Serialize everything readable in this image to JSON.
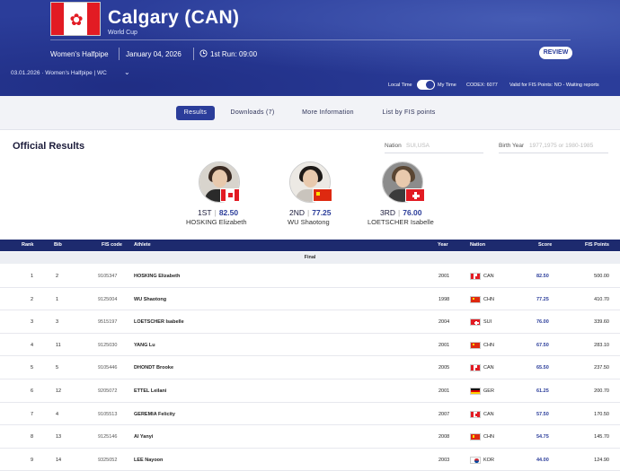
{
  "header": {
    "title": "Calgary (CAN)",
    "subtitle": "World Cup",
    "discipline": "Women's Halfpipe",
    "date": "January 04, 2026",
    "first_run": "1st Run: 09:00",
    "review_label": "REVIEW",
    "breadcrumb": "03.01.2026 · Women's Halfpipe | WC",
    "local_time": "Local Time",
    "my_time": "My Time",
    "codex": "CODEX: 6077",
    "fis_points": "Valid for FIS Points: NO - Waiting reports",
    "colors": {
      "primary": "#2b3d9a",
      "dark": "#1d2a6e"
    }
  },
  "tabs": [
    {
      "label": "Results",
      "active": true
    },
    {
      "label": "Downloads (7)",
      "active": false
    },
    {
      "label": "More Information",
      "active": false
    },
    {
      "label": "List by FIS points",
      "active": false
    }
  ],
  "filters": {
    "title": "Official Results",
    "nation_label": "Nation",
    "nation_placeholder": "SUI,USA",
    "birth_label": "Birth Year",
    "birth_placeholder": "1977,1975 or 1980-1985"
  },
  "podium": [
    {
      "place": "1ST",
      "score": "82.50",
      "name": "HOSKING Elizabeth",
      "nation": "CAN"
    },
    {
      "place": "2ND",
      "score": "77.25",
      "name": "WU Shaotong",
      "nation": "CHN"
    },
    {
      "place": "3RD",
      "score": "76.00",
      "name": "LOETSCHER Isabelle",
      "nation": "SUI"
    }
  ],
  "table": {
    "columns": {
      "rank": "Rank",
      "bib": "Bib",
      "fis_code": "FIS code",
      "athlete": "Athlete",
      "year": "Year",
      "nation": "Nation",
      "score": "Score",
      "fis_points": "FIS Points"
    },
    "section": "Final",
    "rows": [
      {
        "rank": "1",
        "bib": "2",
        "code": "9105347",
        "athlete": "HOSKING Elizabeth",
        "year": "2001",
        "nation": "CAN",
        "score": "82.50",
        "points": "500.00"
      },
      {
        "rank": "2",
        "bib": "1",
        "code": "9125004",
        "athlete": "WU Shaotong",
        "year": "1998",
        "nation": "CHN",
        "score": "77.25",
        "points": "410.70"
      },
      {
        "rank": "3",
        "bib": "3",
        "code": "9515197",
        "athlete": "LOETSCHER Isabelle",
        "year": "2004",
        "nation": "SUI",
        "score": "76.00",
        "points": "339.60"
      },
      {
        "rank": "4",
        "bib": "11",
        "code": "9125030",
        "athlete": "YANG Lu",
        "year": "2001",
        "nation": "CHN",
        "score": "67.50",
        "points": "283.10"
      },
      {
        "rank": "5",
        "bib": "5",
        "code": "9105446",
        "athlete": "DHONDT Brooke",
        "year": "2005",
        "nation": "CAN",
        "score": "65.50",
        "points": "237.50"
      },
      {
        "rank": "6",
        "bib": "12",
        "code": "9205072",
        "athlete": "ETTEL Leilani",
        "year": "2001",
        "nation": "GER",
        "score": "61.25",
        "points": "200.70"
      },
      {
        "rank": "7",
        "bib": "4",
        "code": "9105513",
        "athlete": "GEREMIA Felicity",
        "year": "2007",
        "nation": "CAN",
        "score": "57.50",
        "points": "170.50"
      },
      {
        "rank": "8",
        "bib": "13",
        "code": "9125146",
        "athlete": "AI Yanyi",
        "year": "2008",
        "nation": "CHN",
        "score": "54.75",
        "points": "145.70"
      },
      {
        "rank": "9",
        "bib": "14",
        "code": "9325052",
        "athlete": "LEE Nayoon",
        "year": "2003",
        "nation": "KOR",
        "score": "44.00",
        "points": "124.90"
      }
    ]
  }
}
